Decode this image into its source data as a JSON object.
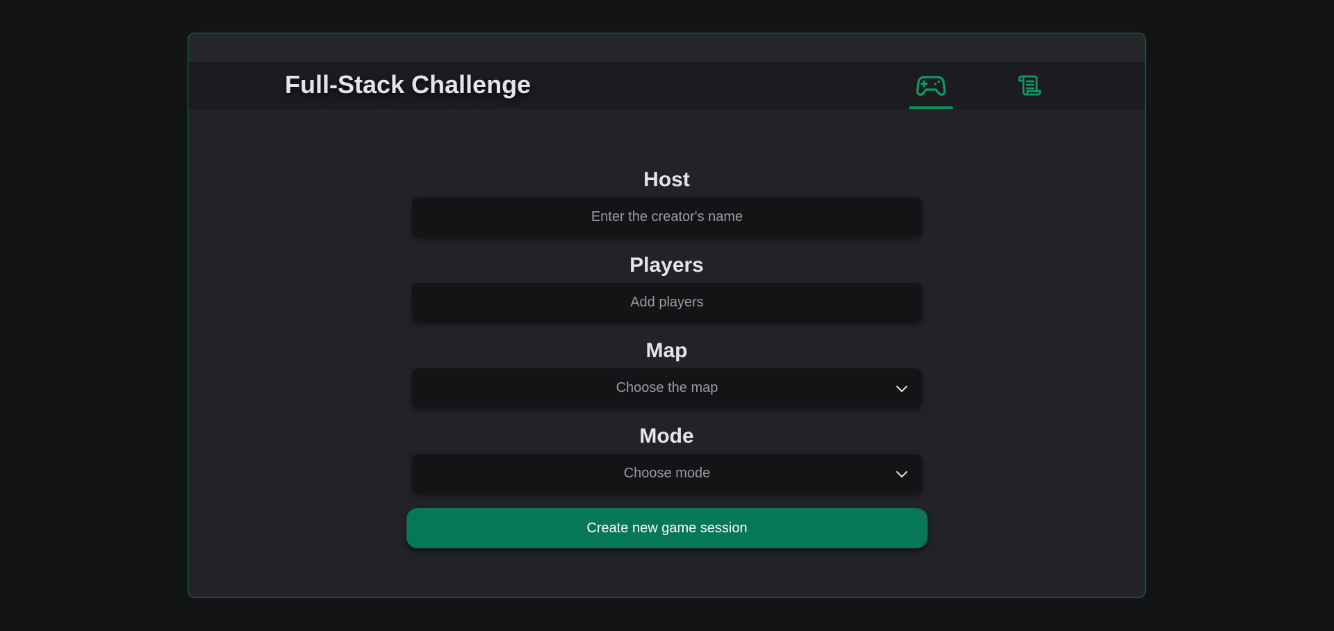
{
  "header": {
    "title": "Full-Stack Challenge"
  },
  "nav": {
    "tabs": [
      {
        "icon": "gamepad-icon",
        "active": true
      },
      {
        "icon": "scroll-icon",
        "active": false
      }
    ]
  },
  "form": {
    "host": {
      "label": "Host",
      "placeholder": "Enter the creator's name",
      "value": ""
    },
    "players": {
      "label": "Players",
      "placeholder": "Add players",
      "value": ""
    },
    "map": {
      "label": "Map",
      "selected": "Choose the map"
    },
    "mode": {
      "label": "Mode",
      "selected": "Choose mode"
    },
    "submit_label": "Create new game session"
  },
  "colors": {
    "accent": "#077855",
    "accent_border": "#1d6e4c",
    "background": "#131416",
    "card": "#222328",
    "field": "#131416"
  }
}
